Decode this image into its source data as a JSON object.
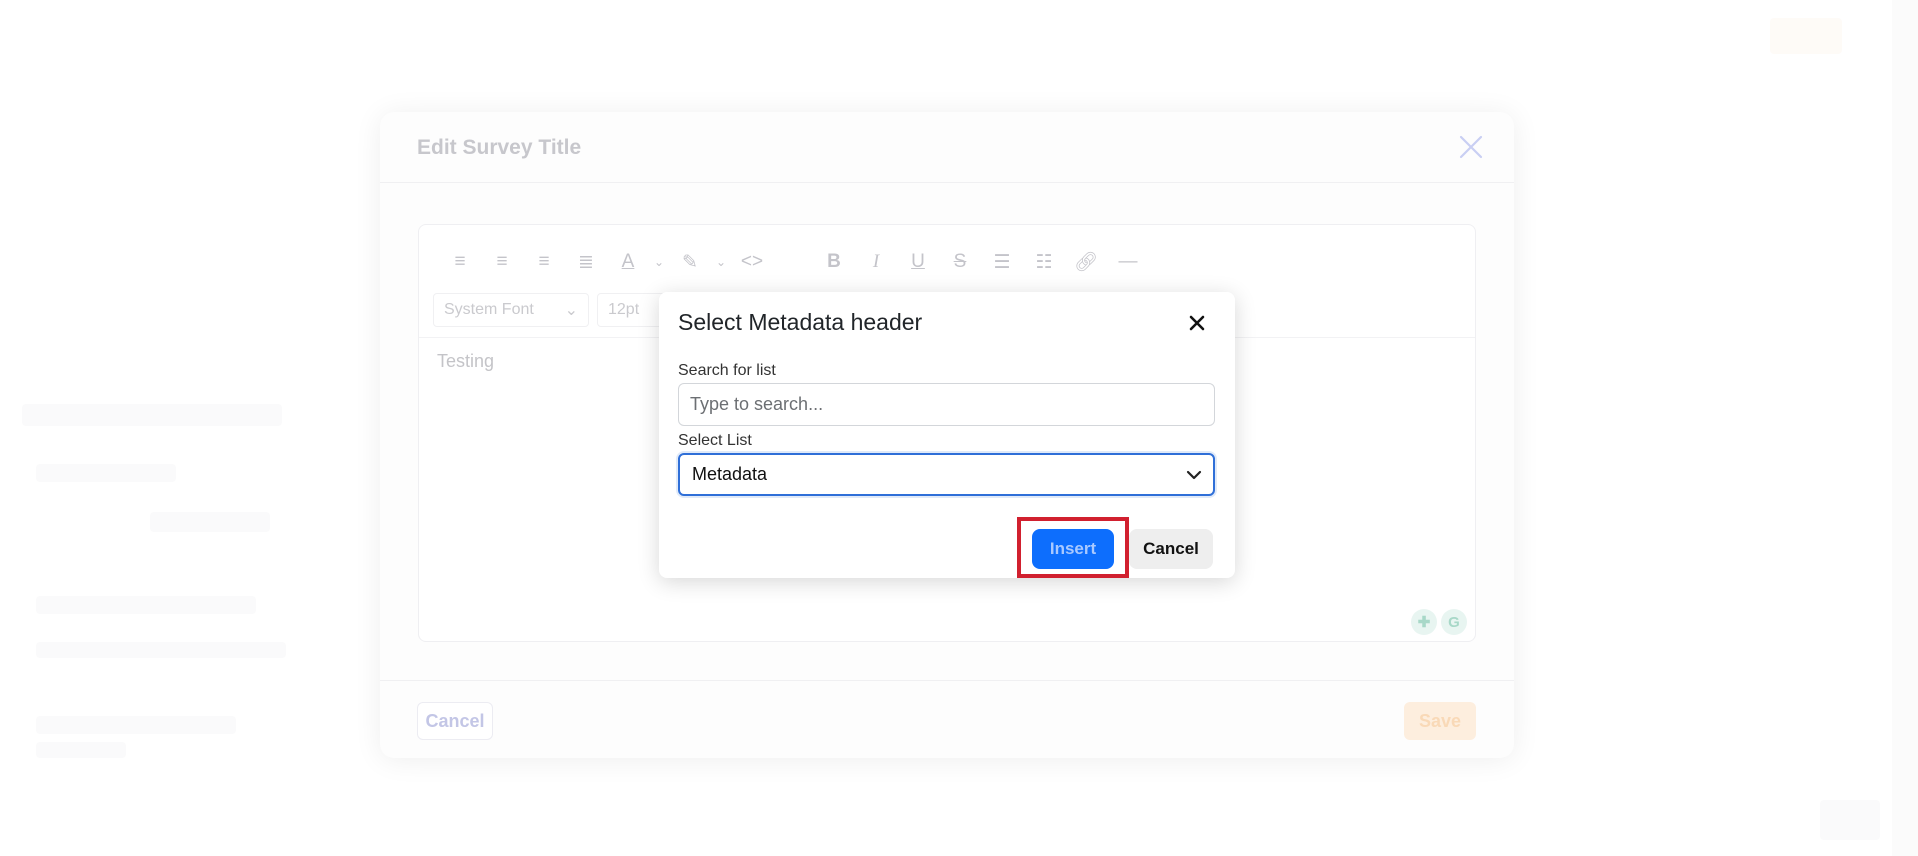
{
  "edit_modal": {
    "title": "Edit Survey Title",
    "toolbar": {
      "icons": [
        "align-left-icon",
        "align-center-icon",
        "align-right-icon",
        "align-justify-icon",
        "text-color-icon",
        "highlight-color-icon",
        "code-icon",
        "bold-icon",
        "italic-icon",
        "underline-icon",
        "strikethrough-icon",
        "bullet-list-icon",
        "numbered-list-icon",
        "link-icon",
        "horizontal-rule-icon"
      ],
      "font_family": "System Font",
      "font_size": "12pt"
    },
    "content": "Testing",
    "cancel_label": "Cancel",
    "save_label": "Save"
  },
  "metadata_dialog": {
    "title": "Select Metadata header",
    "search": {
      "label": "Search for list",
      "placeholder": "Type to search...",
      "value": ""
    },
    "select_list": {
      "label": "Select List",
      "selected": "Metadata"
    },
    "insert_label": "Insert",
    "cancel_label": "Cancel"
  },
  "colors": {
    "primary": "#0d6efd",
    "focus_border": "#2f6fd8",
    "highlight_frame": "#d1202f",
    "save_faded": "#fdeede"
  }
}
